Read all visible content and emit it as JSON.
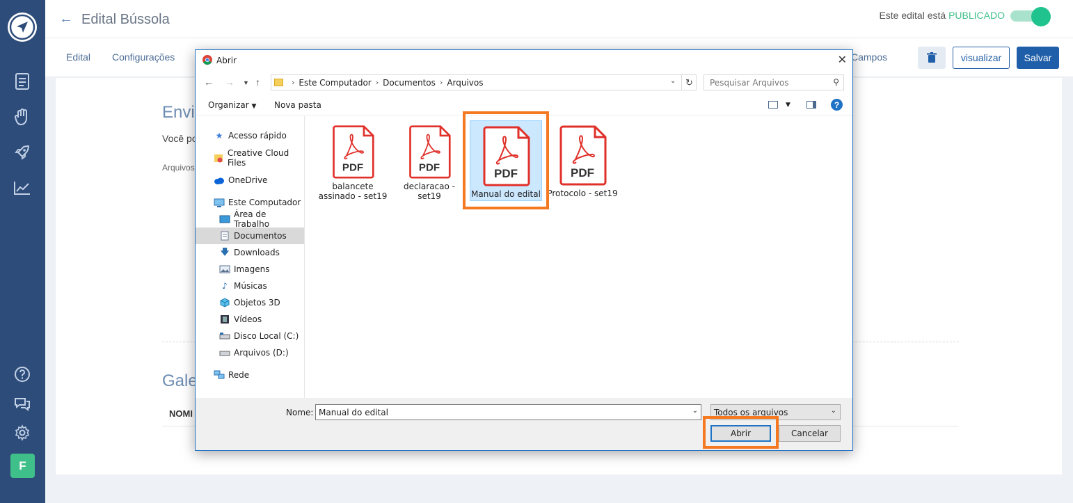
{
  "colors": {
    "sidebar_bg": "#2d4c7a",
    "accent_green": "#3fbf8a",
    "primary_blue": "#1f5ea8",
    "highlight_orange": "#f47920",
    "dialog_border": "#1f73c6"
  },
  "sidebar": {
    "icons": [
      "logo-navigation-icon",
      "document-icon",
      "hand-icon",
      "rocket-icon",
      "chart-icon",
      "help-icon",
      "chat-icon",
      "gear-icon"
    ],
    "avatar_letter": "F"
  },
  "header": {
    "title": "Edital Bússola",
    "status_prefix": "Este edital está",
    "status_value": "PUBLICADO"
  },
  "tabs": [
    {
      "label": "Edital"
    },
    {
      "label": "Configurações"
    },
    {
      "label": "Campos"
    }
  ],
  "toolbar": {
    "view_label": "visualizar",
    "save_label": "Salvar"
  },
  "main": {
    "section1_title": "Envi",
    "section1_text": "Você po",
    "section1_small": "Arquivos",
    "section2_title": "Gale",
    "col_header": "NOMI"
  },
  "dialog": {
    "title": "Abrir",
    "breadcrumb": [
      "Este Computador",
      "Documentos",
      "Arquivos"
    ],
    "search_placeholder": "Pesquisar Arquivos",
    "organize_label": "Organizar",
    "new_folder_label": "Nova pasta",
    "nav_items": [
      {
        "label": "Acesso rápido",
        "icon": "star-icon"
      },
      {
        "label": "Creative Cloud Files",
        "icon": "creative-cloud-icon"
      },
      {
        "label": "OneDrive",
        "icon": "cloud-icon"
      },
      {
        "label": "Este Computador",
        "icon": "computer-icon"
      },
      {
        "label": "Área de Trabalho",
        "icon": "desktop-icon"
      },
      {
        "label": "Documentos",
        "icon": "documents-icon",
        "selected": true
      },
      {
        "label": "Downloads",
        "icon": "download-icon"
      },
      {
        "label": "Imagens",
        "icon": "images-icon"
      },
      {
        "label": "Músicas",
        "icon": "music-icon"
      },
      {
        "label": "Objetos 3D",
        "icon": "cube-icon"
      },
      {
        "label": "Vídeos",
        "icon": "video-icon"
      },
      {
        "label": "Disco Local (C:)",
        "icon": "drive-icon"
      },
      {
        "label": "Arquivos (D:)",
        "icon": "drive-icon"
      },
      {
        "label": "Rede",
        "icon": "network-icon"
      }
    ],
    "files": [
      {
        "name_line1": "balancete",
        "name_line2": "assinado - set19",
        "icon_text": "PDF"
      },
      {
        "name_line1": "declaracao -",
        "name_line2": "set19",
        "icon_text": "PDF"
      },
      {
        "name_line1": "Manual do edital",
        "name_line2": "",
        "icon_text": "PDF",
        "selected": true
      },
      {
        "name_line1": "Protocolo - set19",
        "name_line2": "",
        "icon_text": "PDF"
      }
    ],
    "name_label": "Nome:",
    "name_value": "Manual do edital",
    "file_type": "Todos os arquivos",
    "open_label": "Abrir",
    "cancel_label": "Cancelar"
  }
}
